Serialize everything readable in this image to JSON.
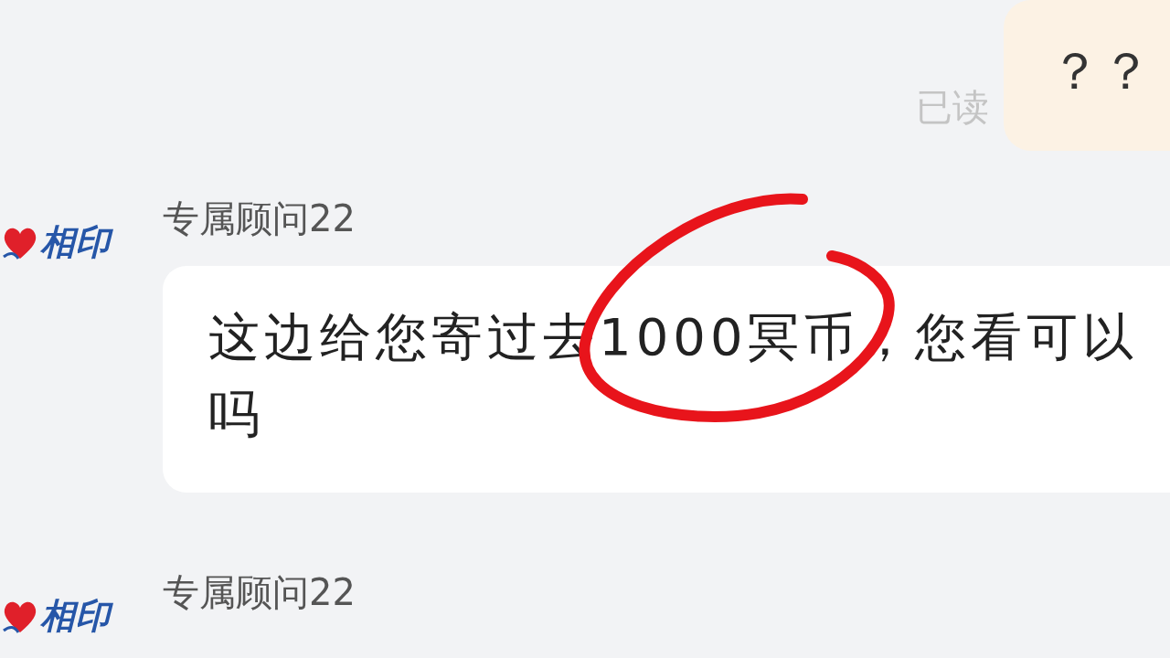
{
  "messages": [
    {
      "kind": "outgoing",
      "text": "？？",
      "receipt": "已读"
    },
    {
      "kind": "incoming",
      "sender": "专属顾问22",
      "logo": "相印",
      "text": "这边给您寄过去1000冥币，您看可以吗",
      "annotated": true
    },
    {
      "kind": "incoming",
      "sender": "专属顾问22",
      "logo": "相印"
    }
  ]
}
